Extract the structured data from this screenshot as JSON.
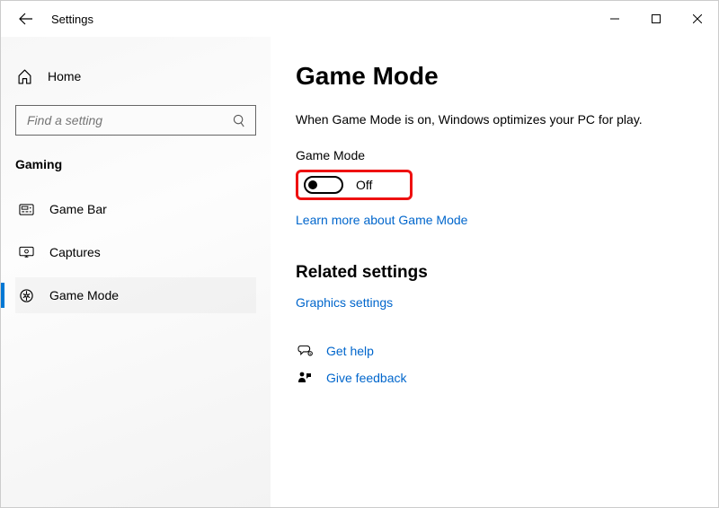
{
  "window": {
    "title": "Settings"
  },
  "sidebar": {
    "home": "Home",
    "search_placeholder": "Find a setting",
    "section": "Gaming",
    "items": [
      {
        "label": "Game Bar"
      },
      {
        "label": "Captures"
      },
      {
        "label": "Game Mode"
      }
    ],
    "active_index": 2
  },
  "main": {
    "heading": "Game Mode",
    "description": "When Game Mode is on, Windows optimizes your PC for play.",
    "toggle_label": "Game Mode",
    "toggle_state": "Off",
    "learn_more": "Learn more about Game Mode",
    "related_heading": "Related settings",
    "related_link": "Graphics settings",
    "get_help": "Get help",
    "give_feedback": "Give feedback"
  }
}
